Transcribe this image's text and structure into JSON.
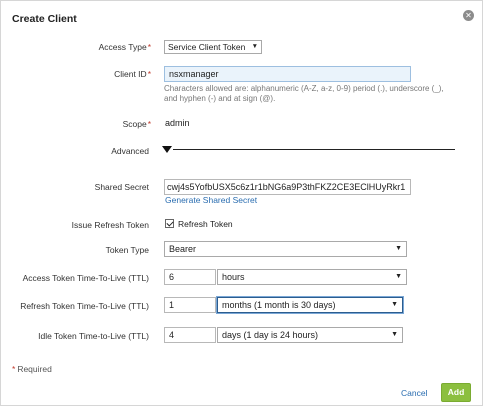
{
  "dialog": {
    "title": "Create Client",
    "close_icon": "close-icon"
  },
  "form": {
    "access_type": {
      "label": "Access Type",
      "required_mark": "*",
      "value": "Service Client Token"
    },
    "client_id": {
      "label": "Client ID",
      "required_mark": "*",
      "value": "nsxmanager",
      "hint": "Characters allowed are: alphanumeric (A-Z, a-z, 0-9) period (.), underscore (_), and hyphen (-) and at sign (@)."
    },
    "scope": {
      "label": "Scope",
      "required_mark": "*",
      "value": "admin"
    },
    "advanced": {
      "label": "Advanced"
    },
    "shared_secret": {
      "label": "Shared Secret",
      "value": "cwj4s5YofbUSX5c6z1r1bNG6a9P3thFKZ2CE3EClHUyRkr1",
      "generate_link": "Generate Shared Secret"
    },
    "issue_refresh_token": {
      "label": "Issue Refresh Token",
      "checkbox_label": "Refresh Token",
      "checked": true
    },
    "token_type": {
      "label": "Token Type",
      "value": "Bearer"
    },
    "access_ttl": {
      "label": "Access Token Time-To-Live (TTL)",
      "value": "6",
      "unit": "hours"
    },
    "refresh_ttl": {
      "label": "Refresh Token Time-To-Live (TTL)",
      "value": "1",
      "unit": "months (1 month is 30 days)"
    },
    "idle_ttl": {
      "label": "Idle Token Time-to-Live (TTL)",
      "value": "4",
      "unit": "days (1 day is 24 hours)"
    }
  },
  "footer": {
    "required_note_mark": "*",
    "required_note": "Required",
    "cancel_label": "Cancel",
    "add_label": "Add"
  },
  "colors": {
    "accent_green": "#8cbf3f",
    "link_blue": "#2a6db0",
    "required_red": "#c0392b"
  }
}
